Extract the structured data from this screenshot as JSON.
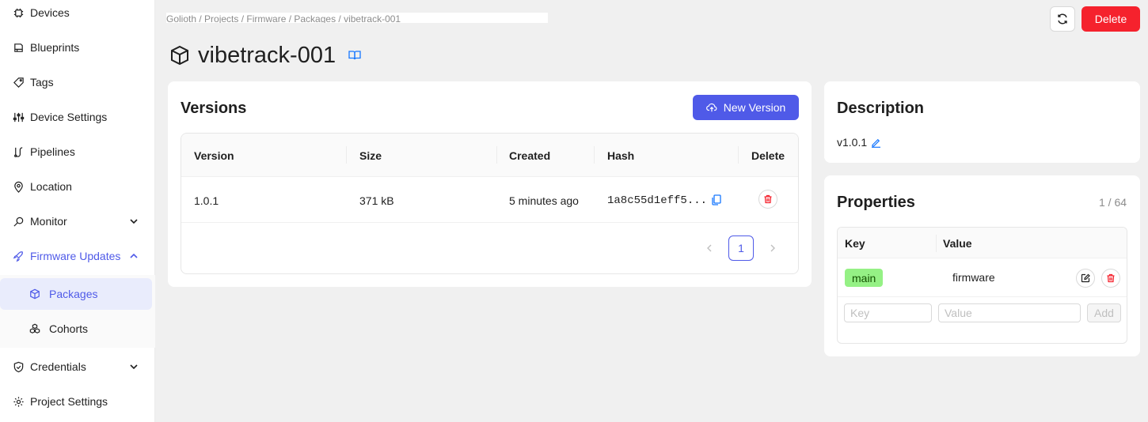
{
  "sidebar": {
    "items": [
      {
        "label": "Devices",
        "icon": "chip-icon"
      },
      {
        "label": "Blueprints",
        "icon": "blueprint-icon"
      },
      {
        "label": "Tags",
        "icon": "tag-icon"
      },
      {
        "label": "Device Settings",
        "icon": "sliders-icon"
      },
      {
        "label": "Pipelines",
        "icon": "pipeline-icon"
      },
      {
        "label": "Location",
        "icon": "location-pin-icon"
      },
      {
        "label": "Monitor",
        "icon": "monitor-icon"
      },
      {
        "label": "Firmware Updates",
        "icon": "rocket-icon"
      },
      {
        "label": "Credentials",
        "icon": "shield-icon"
      },
      {
        "label": "Project Settings",
        "icon": "gear-icon"
      }
    ],
    "firmware_subitems": [
      {
        "label": "Packages",
        "icon": "package-icon"
      },
      {
        "label": "Cohorts",
        "icon": "cohorts-icon"
      }
    ]
  },
  "header": {
    "breadcrumb": "Golioth / Projects / Firmware / Packages / vibetrack-001",
    "delete_label": "Delete"
  },
  "page": {
    "title": "vibetrack-001"
  },
  "versions": {
    "title": "Versions",
    "new_version_label": "New Version",
    "columns": [
      "Version",
      "Size",
      "Created",
      "Hash",
      "Delete"
    ],
    "rows": [
      {
        "version": "1.0.1",
        "size": "371 kB",
        "created": "5 minutes ago",
        "hash": "1a8c55d1eff5..."
      }
    ],
    "pagination": {
      "current_page": "1"
    }
  },
  "description": {
    "title": "Description",
    "text": "v1.0.1"
  },
  "properties": {
    "title": "Properties",
    "count": "1 / 64",
    "columns": [
      "Key",
      "Value"
    ],
    "rows": [
      {
        "key": "main",
        "value": "firmware"
      }
    ],
    "key_placeholder": "Key",
    "value_placeholder": "Value",
    "add_label": "Add"
  },
  "colors": {
    "accent": "#4f5ae8",
    "danger": "#f5222d",
    "tag_green": "#95f185"
  }
}
